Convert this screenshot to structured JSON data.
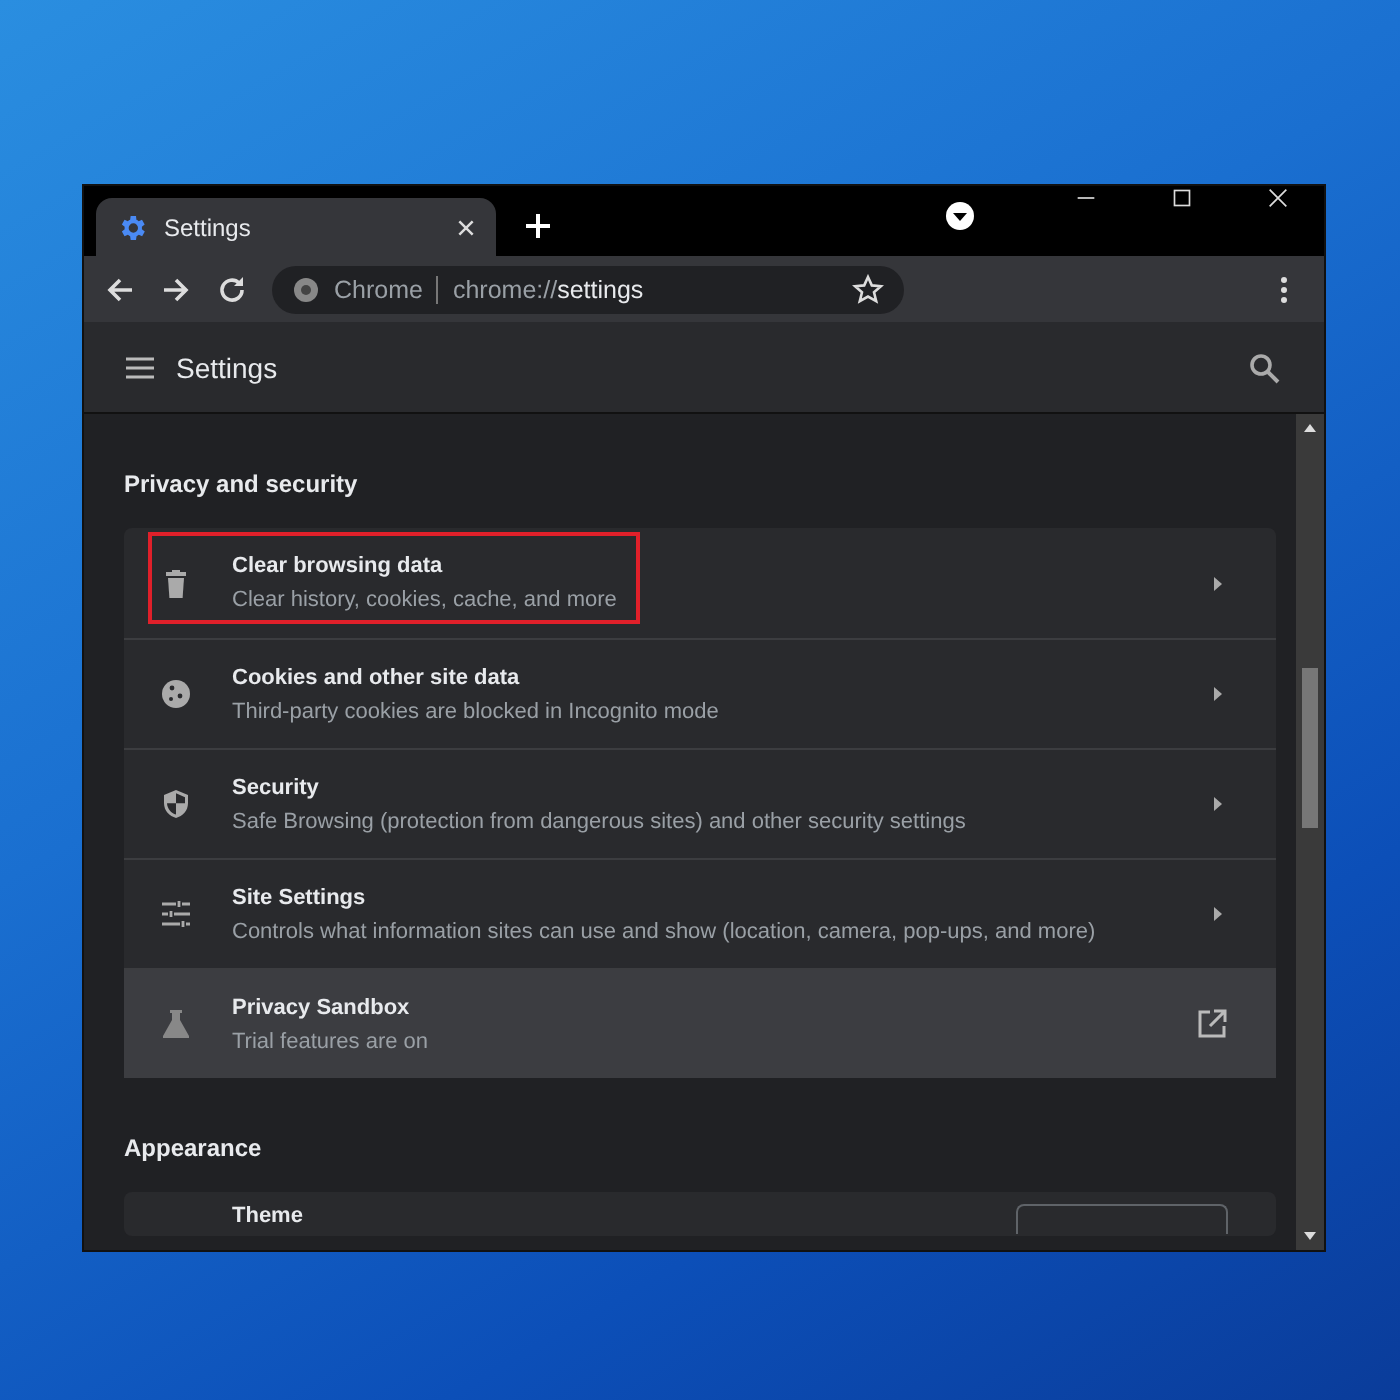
{
  "tab": {
    "title": "Settings",
    "selected": true
  },
  "address_bar": {
    "site_label": "Chrome",
    "url_prefix": "chrome://",
    "url_path": "settings"
  },
  "header": {
    "title": "Settings"
  },
  "sections": [
    {
      "title": "Privacy and security",
      "rows": [
        {
          "title": "Clear browsing data",
          "subtitle": "Clear history, cookies, cache, and more",
          "kind": "link",
          "highlighted": false,
          "annotated": true
        },
        {
          "title": "Cookies and other site data",
          "subtitle": "Third-party cookies are blocked in Incognito mode",
          "kind": "link",
          "highlighted": false,
          "annotated": false
        },
        {
          "title": "Security",
          "subtitle": "Safe Browsing (protection from dangerous sites) and other security settings",
          "kind": "link",
          "highlighted": false,
          "annotated": false
        },
        {
          "title": "Site Settings",
          "subtitle": "Controls what information sites can use and show (location, camera, pop-ups, and more)",
          "kind": "link",
          "highlighted": false,
          "annotated": false
        },
        {
          "title": "Privacy Sandbox",
          "subtitle": "Trial features are on",
          "kind": "external",
          "highlighted": true,
          "annotated": false
        }
      ]
    },
    {
      "title": "Appearance",
      "rows": [
        {
          "title": "Theme",
          "kind": "dropdown",
          "highlighted": false,
          "annotated": false
        }
      ]
    }
  ]
}
